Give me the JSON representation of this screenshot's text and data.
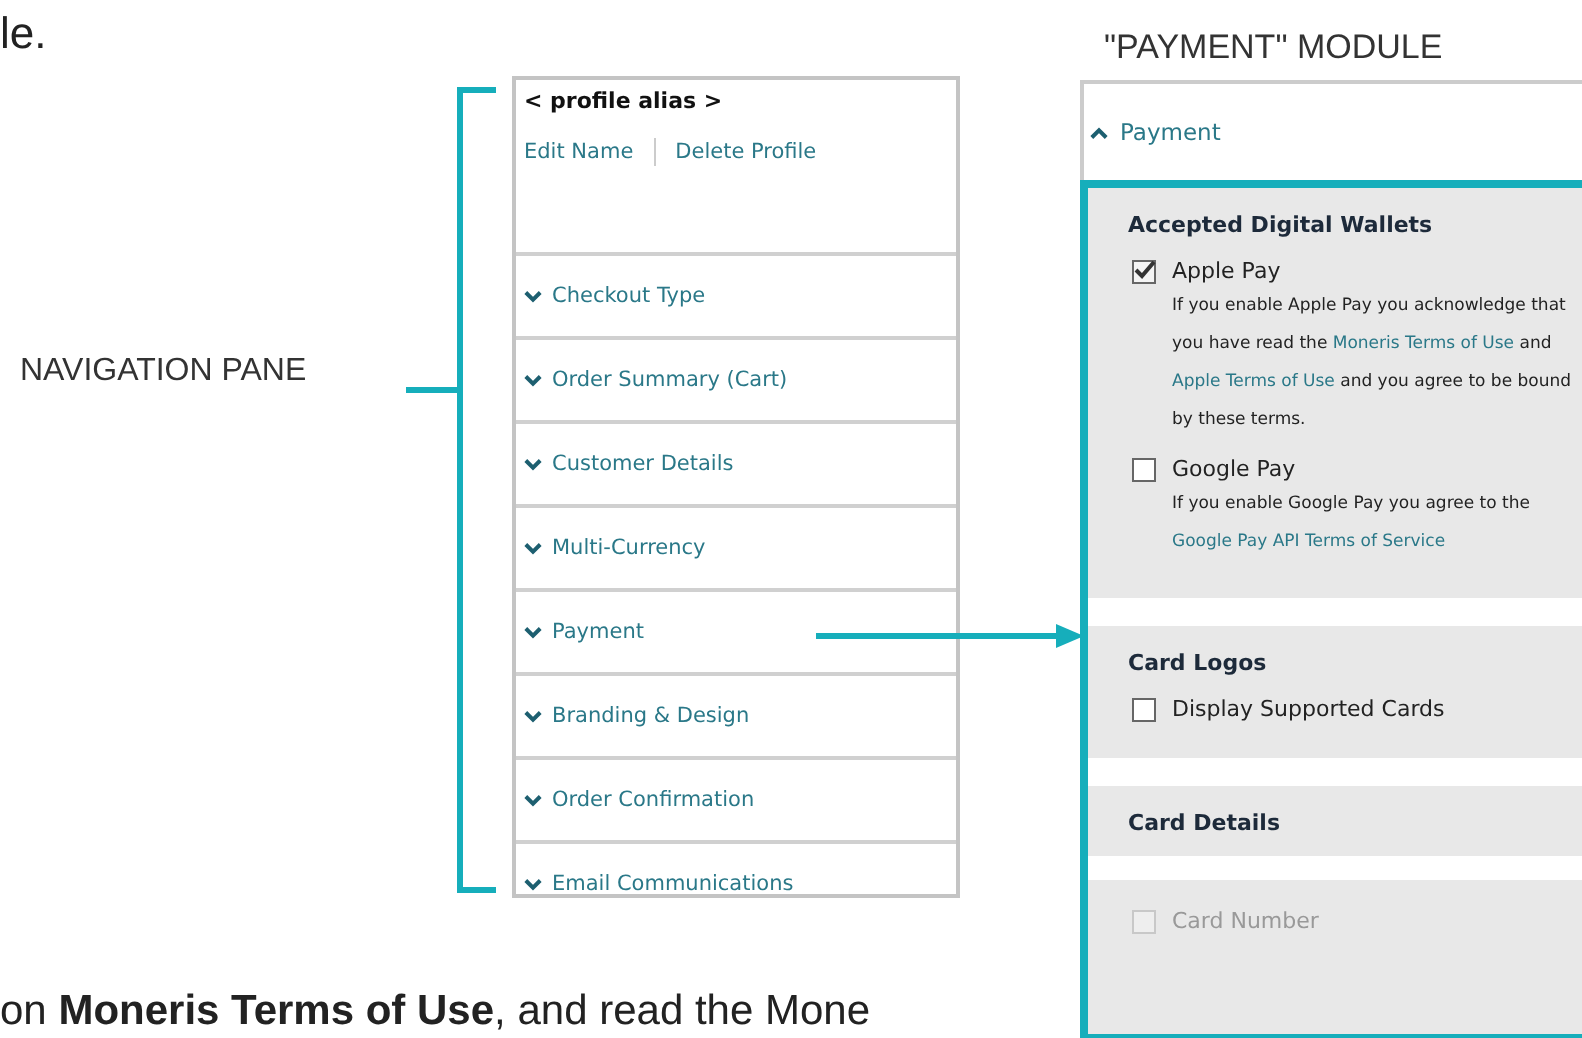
{
  "body_text": {
    "top": "le.",
    "bottom": "on **Moneris Terms of Use**, and read the Mone"
  },
  "callouts": [
    {
      "kind": "bracket",
      "label": "NAVIGATION PANE"
    },
    {
      "kind": "heading",
      "label": "\"PAYMENT\" MODULE"
    }
  ],
  "navigation_pane": {
    "profile_alias": "< profile alias >",
    "links": [
      "Edit Name",
      "Delete Profile"
    ],
    "items": [
      {
        "label": "Checkout Type",
        "expanded": false
      },
      {
        "label": "Order Summary (Cart)",
        "expanded": false
      },
      {
        "label": "Customer Details",
        "expanded": false
      },
      {
        "label": "Multi-Currency",
        "expanded": false
      },
      {
        "label": "Payment",
        "expanded": false
      },
      {
        "label": "Branding & Design",
        "expanded": false
      },
      {
        "label": "Order Confirmation",
        "expanded": false
      },
      {
        "label": "Email Communications",
        "expanded": false
      }
    ]
  },
  "payment_module": {
    "header": {
      "label": "Payment",
      "expanded": true
    },
    "sections": [
      {
        "title": "Accepted Digital Wallets",
        "options": [
          {
            "label": "Apple Pay",
            "checked": true,
            "disabled": false,
            "description": [
              {
                "kind": "text",
                "text": "If you enable Apple Pay you acknowledge that you have read the "
              },
              {
                "kind": "link",
                "text": "Moneris Terms of Use"
              },
              {
                "kind": "text",
                "text": " and "
              },
              {
                "kind": "link",
                "text": "Apple Terms of Use"
              },
              {
                "kind": "text",
                "text": " and you agree to be bound by these terms."
              }
            ]
          },
          {
            "label": "Google Pay",
            "checked": false,
            "disabled": false,
            "description": [
              {
                "kind": "text",
                "text": "If you enable Google Pay you agree to the "
              },
              {
                "kind": "link",
                "text": "Google Pay API Terms of Service"
              }
            ]
          }
        ]
      },
      {
        "title": "Card Logos",
        "options": [
          {
            "label": "Display Supported Cards",
            "checked": false,
            "disabled": false
          }
        ]
      },
      {
        "title": "Card Details",
        "covered": true,
        "options": [
          {
            "label": "Card Number",
            "checked": false,
            "disabled": true
          }
        ]
      }
    ]
  }
}
